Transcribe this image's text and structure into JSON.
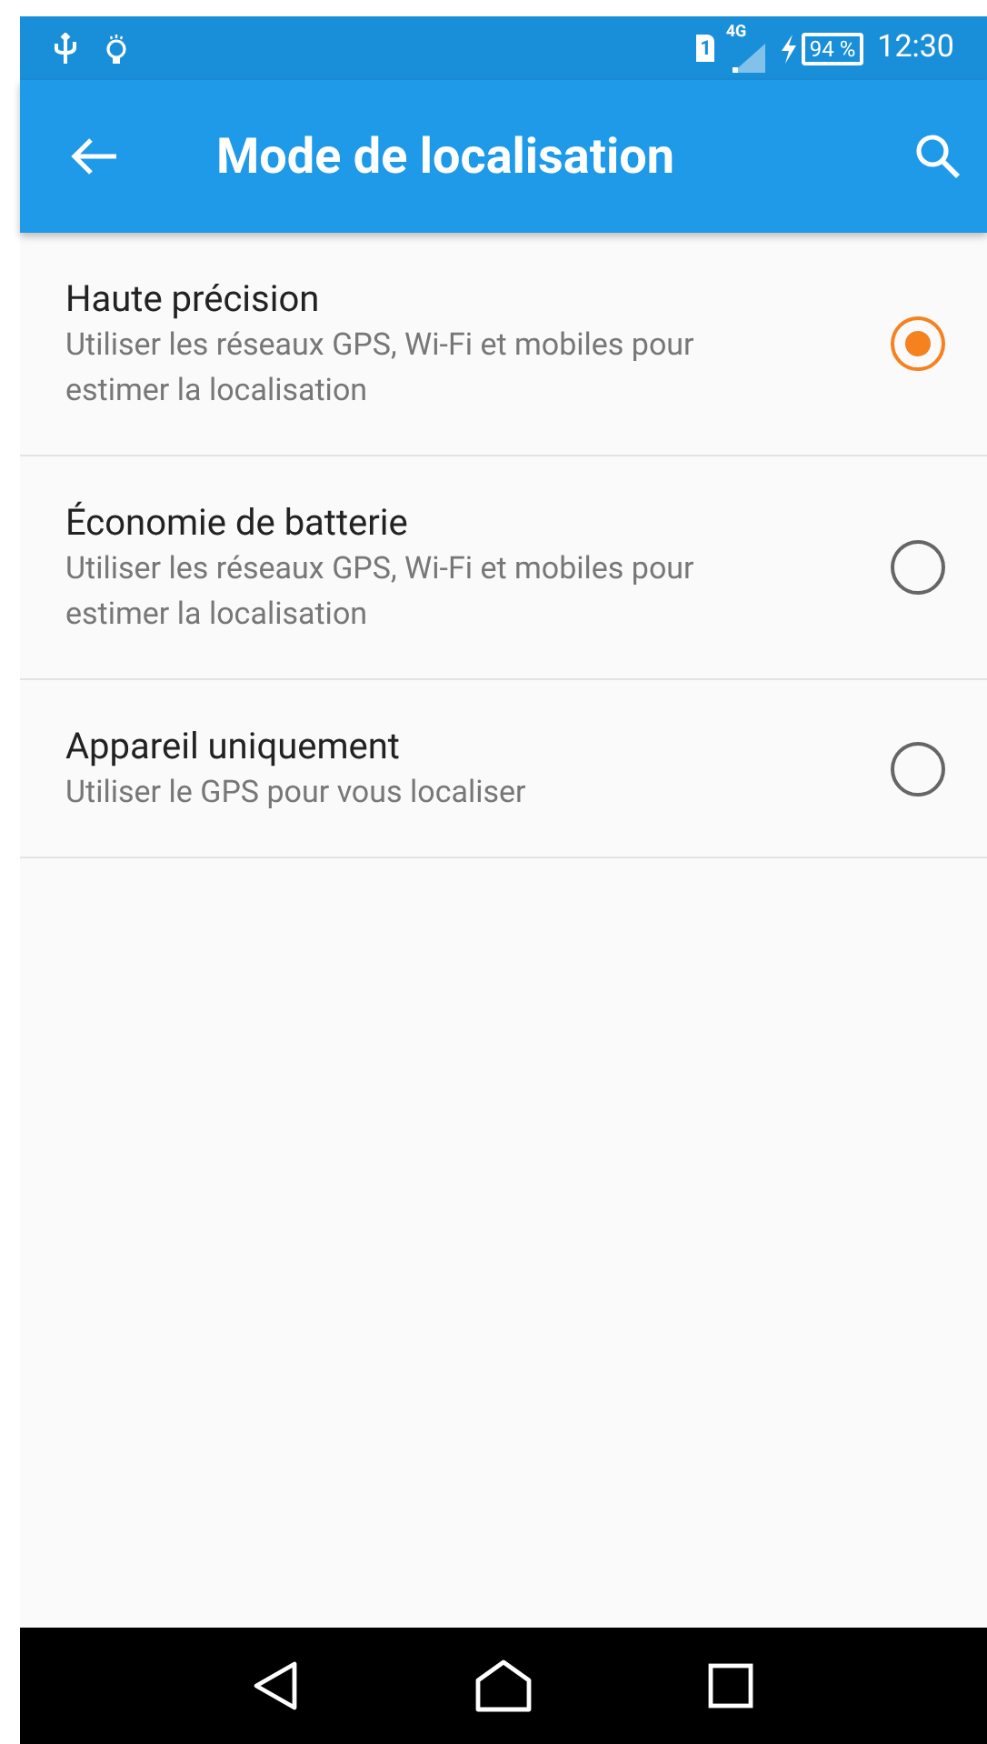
{
  "status_bar": {
    "sim": "1",
    "network": "4G",
    "battery": "94 %",
    "time": "12:30"
  },
  "toolbar": {
    "title": "Mode de localisation"
  },
  "options": [
    {
      "title": "Haute précision",
      "summary": "Utiliser les réseaux GPS, Wi-Fi et mobiles pour estimer la localisation",
      "selected": true
    },
    {
      "title": "Économie de batterie",
      "summary": "Utiliser les réseaux GPS, Wi-Fi et mobiles pour estimer la localisation",
      "selected": false
    },
    {
      "title": "Appareil uniquement",
      "summary": "Utiliser le GPS pour vous localiser",
      "selected": false
    }
  ]
}
